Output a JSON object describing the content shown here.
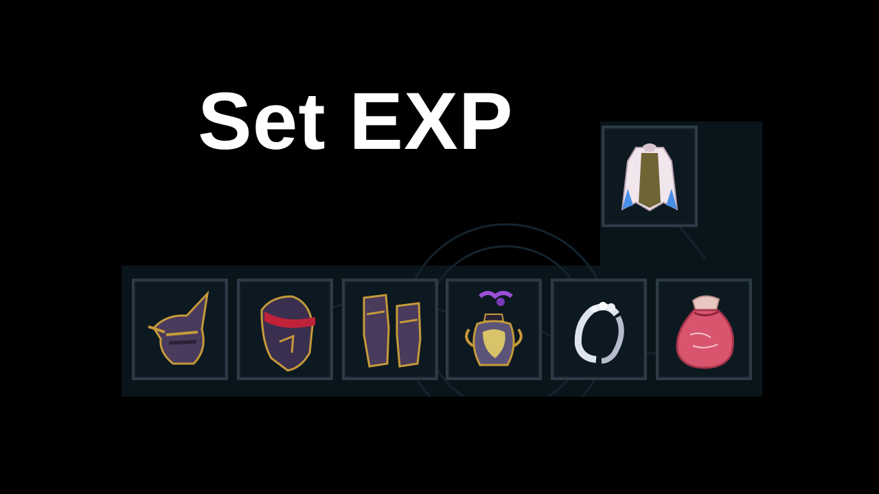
{
  "title": "Set EXP",
  "slots": [
    {
      "name": "cape-slot",
      "icon": "cape-icon"
    },
    {
      "name": "helmet-slot",
      "icon": "helmet-icon"
    },
    {
      "name": "chest-armor-slot",
      "icon": "chest-armor-icon"
    },
    {
      "name": "gauntlets-slot",
      "icon": "gauntlets-icon"
    },
    {
      "name": "urn-slot",
      "icon": "urn-icon"
    },
    {
      "name": "ring-slot",
      "icon": "ring-icon"
    },
    {
      "name": "pouch-slot",
      "icon": "pouch-icon"
    }
  ],
  "colors": {
    "background": "#000000",
    "panel": "#0a141b",
    "slot_border": "#2c3b46",
    "title": "#ffffff"
  }
}
